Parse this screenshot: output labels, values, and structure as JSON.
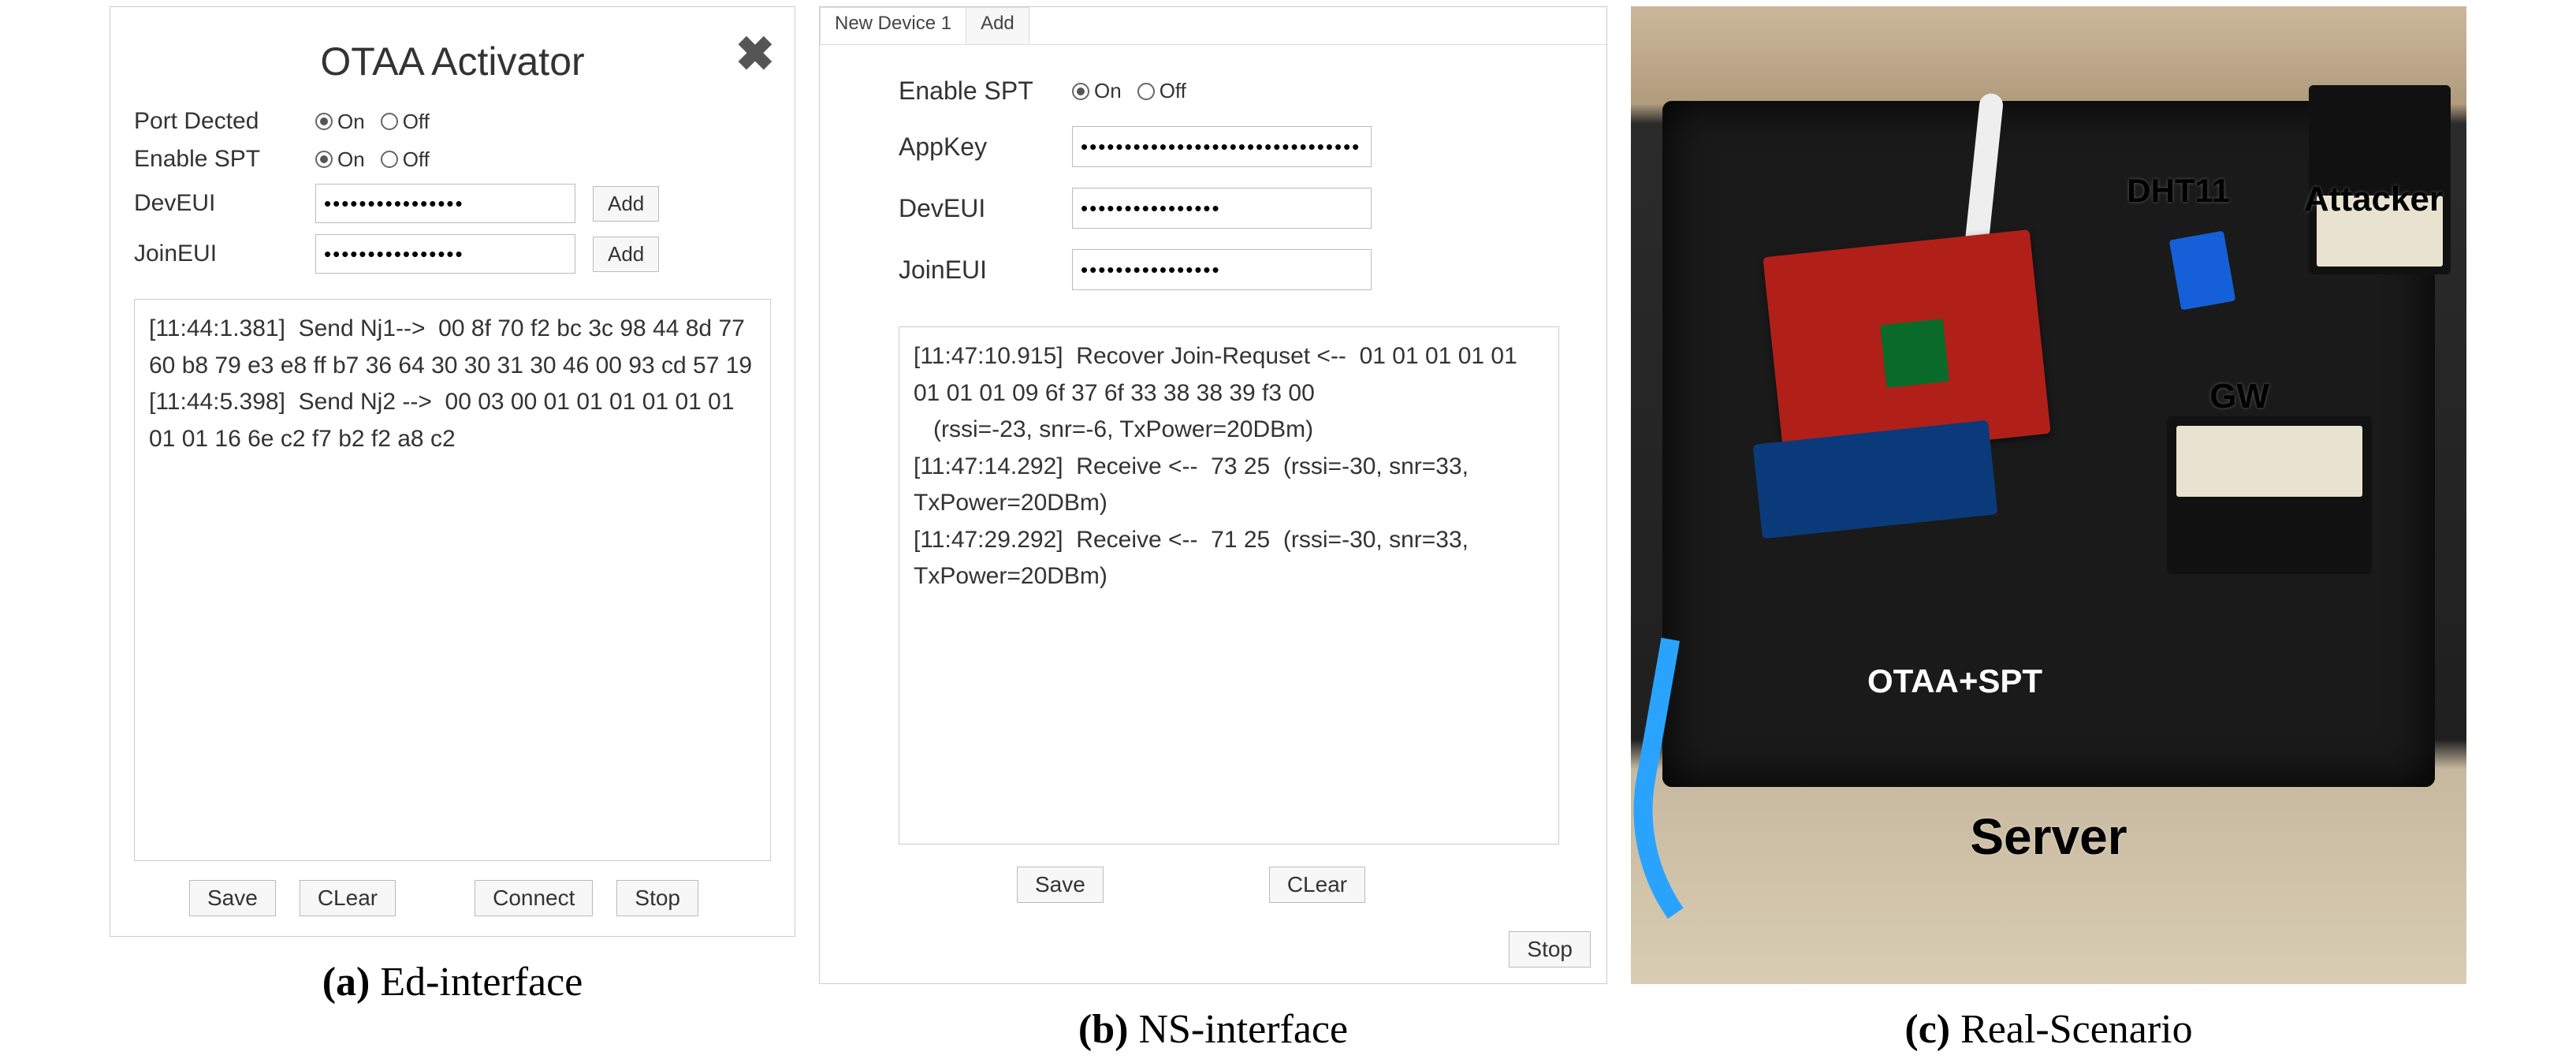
{
  "panel_a": {
    "title": "OTAA Activator",
    "labels": {
      "port_detected": "Port Dected",
      "enable_spt": "Enable SPT",
      "deveui": "DevEUI",
      "joineui": "JoinEUI"
    },
    "radio": {
      "on": "On",
      "off": "Off"
    },
    "inputs": {
      "deveui_value": "••••••••••••••••",
      "joineui_value": "••••••••••••••••"
    },
    "buttons": {
      "add": "Add",
      "save": "Save",
      "clear": "CLear",
      "connect": "Connect",
      "stop": "Stop"
    },
    "log": "[11:44:1.381]  Send Nj1-->  00 8f 70 f2 bc 3c 98 44 8d 77 60 b8 79 e3 e8 ff b7 36 64 30 30 31 30 46 00 93 cd 57 19\n[11:44:5.398]  Send Nj2 -->  00 03 00 01 01 01 01 01 01 01 01 16 6e c2 f7 b2 f2 a8 c2"
  },
  "panel_b": {
    "tabs": {
      "new_device": "New Device 1",
      "add": "Add"
    },
    "labels": {
      "enable_spt": "Enable SPT",
      "appkey": "AppKey",
      "deveui": "DevEUI",
      "joineui": "JoinEUI"
    },
    "radio": {
      "on": "On",
      "off": "Off"
    },
    "inputs": {
      "appkey_value": "••••••••••••••••••••••••••••••••",
      "deveui_value": "••••••••••••••••",
      "joineui_value": "••••••••••••••••"
    },
    "buttons": {
      "save": "Save",
      "clear": "CLear",
      "stop": "Stop"
    },
    "log": "[11:47:10.915]  Recover Join-Requset <--  01 01 01 01 01 01 01 01 09 6f 37 6f 33 38 38 39 f3 00\n   (rssi=-23, snr=-6, TxPower=20DBm)\n[11:47:14.292]  Receive <--  73 25  (rssi=-30, snr=33, TxPower=20DBm)\n[11:47:29.292]  Receive <--  71 25  (rssi=-30, snr=33, TxPower=20DBm)"
  },
  "panel_c": {
    "labels": {
      "dht11": "DHT11",
      "attacker": "Attacker",
      "gw": "GW",
      "otaa_spt": "OTAA+SPT",
      "server": "Server"
    }
  },
  "captions": {
    "a_tag": "(a)",
    "a_text": " Ed-interface",
    "b_tag": "(b)",
    "b_text": " NS-interface",
    "c_tag": "(c)",
    "c_text": " Real-Scenario"
  }
}
